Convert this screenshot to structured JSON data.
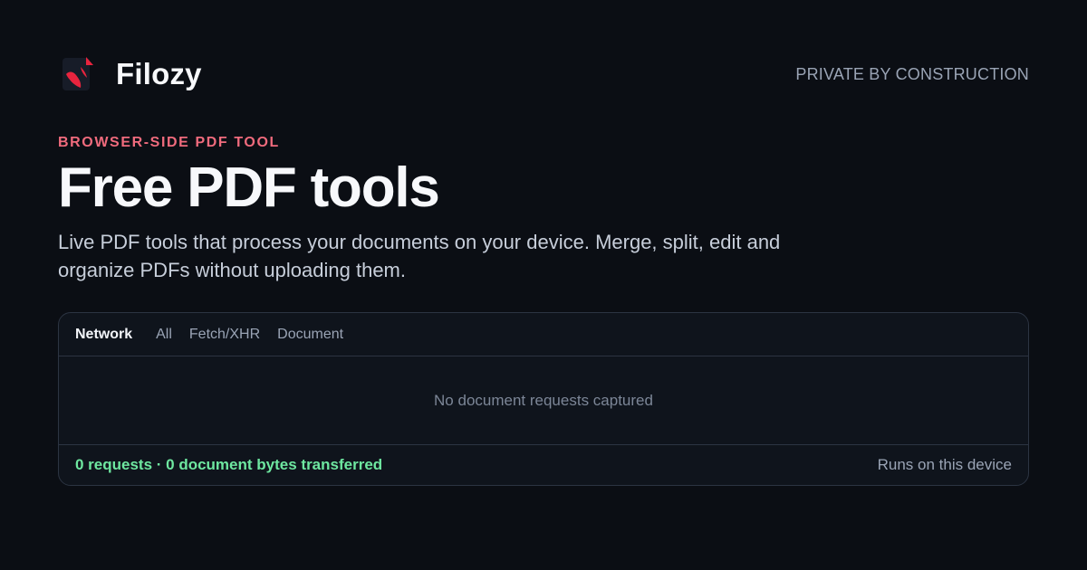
{
  "brand": {
    "name": "Filozy",
    "tagline": "PRIVATE BY CONSTRUCTION",
    "logo_icon": "filozy-logo-icon",
    "logo_color": "#e8243e"
  },
  "hero": {
    "eyebrow": "BROWSER-SIDE PDF TOOL",
    "title": "Free PDF tools",
    "description": "Live PDF tools that process your documents on your device. Merge, split, edit and organize PDFs without uploading them."
  },
  "network_panel": {
    "tabs": [
      {
        "label": "Network",
        "active": true
      },
      {
        "label": "All",
        "active": false
      },
      {
        "label": "Fetch/XHR",
        "active": false
      },
      {
        "label": "Document",
        "active": false
      }
    ],
    "empty_message": "No document requests captured",
    "stats": "0 requests · 0 document bytes transferred",
    "note": "Runs on this device"
  },
  "colors": {
    "background": "#0b0e14",
    "accent": "#f06b7d",
    "success": "#6ee7a0",
    "panel_border": "#2c3442"
  }
}
